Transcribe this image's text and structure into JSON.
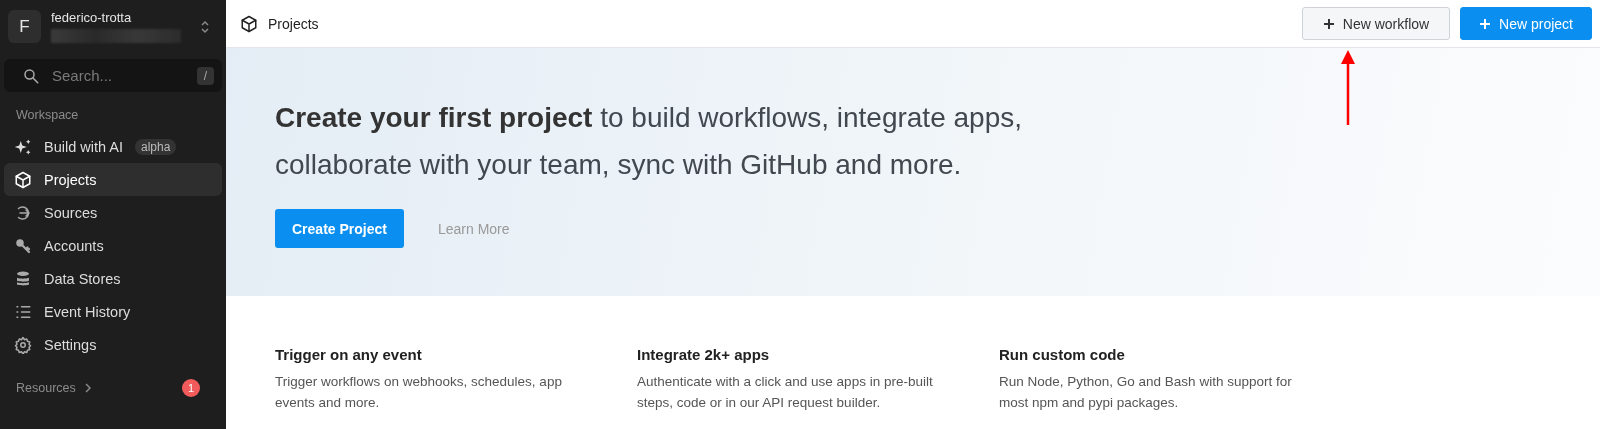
{
  "sidebar": {
    "account": {
      "avatar": "F",
      "name": "federico-trotta"
    },
    "search": {
      "placeholder": "Search...",
      "shortcut": "/"
    },
    "section": "Workspace",
    "items": [
      {
        "label": "Build with AI",
        "badge": "alpha",
        "selected": false
      },
      {
        "label": "Projects",
        "selected": true
      },
      {
        "label": "Sources",
        "selected": false
      },
      {
        "label": "Accounts",
        "selected": false
      },
      {
        "label": "Data Stores",
        "selected": false
      },
      {
        "label": "Event History",
        "selected": false
      },
      {
        "label": "Settings",
        "selected": false
      }
    ],
    "resources": {
      "label": "Resources",
      "count": "1"
    }
  },
  "header": {
    "title": "Projects",
    "buttons": [
      {
        "label": "New workflow",
        "kind": "secondary"
      },
      {
        "label": "New project",
        "kind": "primary"
      }
    ]
  },
  "hero": {
    "title": "**Create your first project** to build workflows, integrate apps, collaborate with your team, sync with GitHub and more.",
    "primary": "Create Project",
    "link": "Learn More"
  },
  "features": [
    {
      "title": "Trigger on any event",
      "text": "Trigger workflows on webhooks, schedules, app events and more."
    },
    {
      "title": "Integrate 2k+ apps",
      "text": "Authenticate with a click and use apps in pre-built steps, code or in our API request builder."
    },
    {
      "title": "Run custom code",
      "text": "Run Node, Python, Go and Bash with support for most npm and pypi packages."
    }
  ]
}
